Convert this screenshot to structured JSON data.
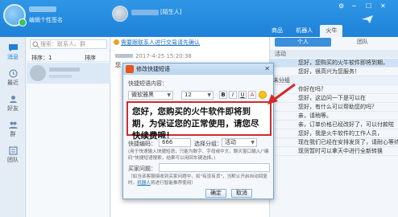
{
  "header": {
    "signature": "编辑个性签名",
    "contact_tag": "[陌生人]",
    "tabs": [
      "商品",
      "机器人",
      "火牛"
    ],
    "window_controls": [
      "⚙",
      "─",
      "☐",
      "✕"
    ]
  },
  "rail": {
    "items": [
      "消息",
      "最近",
      "好友",
      "群",
      "团队"
    ]
  },
  "contacts": {
    "search_placeholder": "搜索：联系人、群",
    "sort_label": "排序：1",
    "sort_by": "排序"
  },
  "chat": {
    "notice": "需要跟联系人进行交易请先确认",
    "message_time": "2017-4-25 15:20:38",
    "message_prefix": "您"
  },
  "right_panel": {
    "tabs": [
      "个人",
      "团队"
    ],
    "section_header": "活动",
    "rows": [
      {
        "text": "您好，您购买的火牛软件即将到期，",
        "type": "sel"
      },
      {
        "text": "您好，很高兴为您服务！",
        "type": "item"
      },
      {
        "text": "未分组",
        "type": "group"
      },
      {
        "text": "你好在吗？",
        "type": "item"
      },
      {
        "text": "您好，这边问一下是可以在",
        "type": "item"
      },
      {
        "text": "您好，有什么可以帮助您的吗？",
        "type": "item"
      },
      {
        "text": "亲，请稍等。",
        "type": "item"
      },
      {
        "text": "亲，订单价格已经改好了，可以付款啦",
        "type": "item"
      },
      {
        "text": "您好，我是火牛软件的工作人员，",
        "type": "item"
      },
      {
        "text": "现在我们已经在安排发货了，请耐心等待",
        "type": "item"
      },
      {
        "text": "现货暂时可以拿天中进行全新转换",
        "type": "item"
      }
    ]
  },
  "dialog": {
    "title": "修改快捷短语",
    "content_label": "快捷短语内容：",
    "font_name": "微软雅黑",
    "font_size": "12",
    "format_buttons": [
      "B",
      "I",
      "U",
      "A"
    ],
    "content": "您好，您购买的火牛软件即将到期，为保证您的正常使用，请您尽快续费哦！",
    "shortcut_label": "快捷编码：",
    "shortcut_value": "666",
    "group_label": "选择分组：",
    "group_value": "活动",
    "hint1": "(用于快速输入快捷短语，只能为数字、字母或中文，聊天窗口输入/\"编码\"快捷短语搜索，结果可以用回车键选择。)",
    "buyer_question_label": "买家问题：",
    "hint2": "（如当该客服接收到买家问题中，如\"有没有货\"，当默认开启自动回复时，",
    "hint2_link": "机器人",
    "hint2_tail": "将进行智能推荐使用）",
    "ok": "确定",
    "cancel": "取消"
  },
  "colors": {
    "accent": "#2f97e6",
    "highlight": "#d22a2a"
  }
}
